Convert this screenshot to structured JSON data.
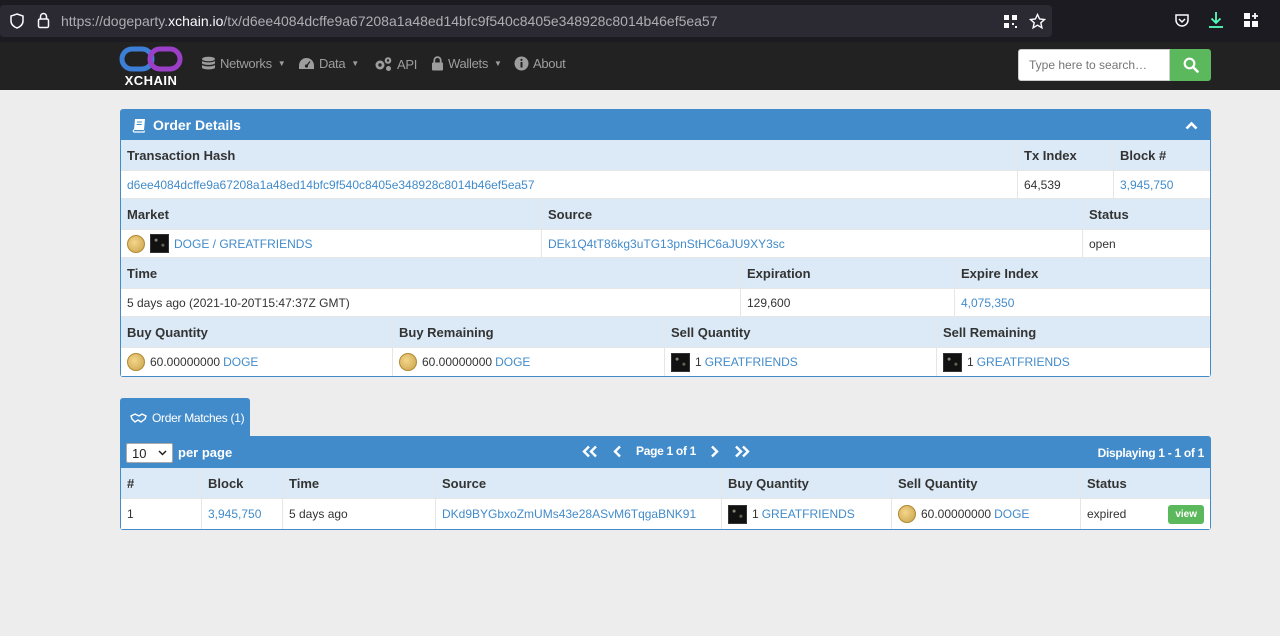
{
  "browser": {
    "url_prefix": "https://dogeparty.",
    "url_domain": "xchain.io",
    "url_path": "/tx/d6ee4084dcffe9a67208a1a48ed14bfc9f540c8405e348928c8014b46ef5ea57"
  },
  "nav": {
    "logo_text": "XCHAIN",
    "items": [
      {
        "label": "Networks",
        "icon": "database-icon",
        "dropdown": true
      },
      {
        "label": "Data",
        "icon": "dashboard-icon",
        "dropdown": true
      },
      {
        "label": "API",
        "icon": "cogs-icon",
        "dropdown": false
      },
      {
        "label": "Wallets",
        "icon": "lock-icon",
        "dropdown": true
      },
      {
        "label": "About",
        "icon": "info-icon",
        "dropdown": false
      }
    ],
    "search_placeholder": "Type here to search…"
  },
  "order": {
    "heading": "Order Details",
    "tx_hash_label": "Transaction Hash",
    "tx_hash": "d6ee4084dcffe9a67208a1a48ed14bfc9f540c8405e348928c8014b46ef5ea57",
    "tx_index_label": "Tx Index",
    "tx_index": "64,539",
    "block_label": "Block #",
    "block": "3,945,750",
    "market_label": "Market",
    "market": "DOGE / GREATFRIENDS",
    "source_label": "Source",
    "source": "DEk1Q4tT86kg3uTG13pnStHC6aJU9XY3sc",
    "status_label": "Status",
    "status": "open",
    "time_label": "Time",
    "time": "5 days ago (2021-10-20T15:47:37Z GMT)",
    "expiration_label": "Expiration",
    "expiration": "129,600",
    "expire_index_label": "Expire Index",
    "expire_index": "4,075,350",
    "buy_qty_label": "Buy Quantity",
    "buy_qty": "60.00000000",
    "buy_qty_asset": "DOGE",
    "buy_rem_label": "Buy Remaining",
    "buy_rem": "60.00000000",
    "buy_rem_asset": "DOGE",
    "sell_qty_label": "Sell Quantity",
    "sell_qty": "1",
    "sell_qty_asset": "GREATFRIENDS",
    "sell_rem_label": "Sell Remaining",
    "sell_rem": "1",
    "sell_rem_asset": "GREATFRIENDS"
  },
  "matches": {
    "tab_label": "Order Matches (1)",
    "per_page_value": "10",
    "per_page_label": "per page",
    "page_label": "Page 1 of 1",
    "displaying": "Displaying 1 - 1 of 1",
    "columns": [
      "#",
      "Block",
      "Time",
      "Source",
      "Buy Quantity",
      "Sell Quantity",
      "Status"
    ],
    "row": {
      "num": "1",
      "block": "3,945,750",
      "time": "5 days ago",
      "source": "DKd9BYGbxoZmUMs43e28ASvM6TqgaBNK91",
      "buy_qty": "1",
      "buy_asset": "GREATFRIENDS",
      "sell_qty": "60.00000000",
      "sell_asset": "DOGE",
      "status": "expired",
      "action": "view"
    }
  },
  "colors": {
    "primary": "#428bca",
    "success": "#5cb85c",
    "navbar": "#222222"
  }
}
